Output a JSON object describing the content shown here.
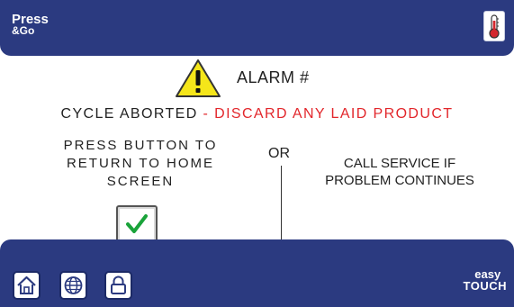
{
  "header": {
    "brand_line1": "Press",
    "brand_line2": "&Go",
    "thermometer_button": {
      "icon": "thermometer-icon"
    }
  },
  "alarm": {
    "icon": "warning-icon",
    "title": "ALARM #",
    "aborted_text": "CYCLE ABORTED",
    "separator": " - ",
    "discard_text": "DISCARD ANY LAID PRODUCT"
  },
  "instructions": {
    "left_lines": [
      "PRESS BUTTON TO",
      "RETURN TO HOME",
      "SCREEN"
    ],
    "or_text": "OR",
    "right_lines": [
      "CALL SERVICE IF",
      "PROBLEM CONTINUES"
    ],
    "confirm_icon": "checkmark-icon"
  },
  "footer": {
    "buttons": [
      {
        "icon": "home-icon"
      },
      {
        "icon": "globe-icon"
      },
      {
        "icon": "lock-icon"
      }
    ],
    "logo_line1": "easy",
    "logo_line2": "TOUCH"
  },
  "colors": {
    "bar": "#2b3a80",
    "alert_red": "#e2262b",
    "warning_yellow": "#f5e61a",
    "check_green": "#1aa33a"
  }
}
